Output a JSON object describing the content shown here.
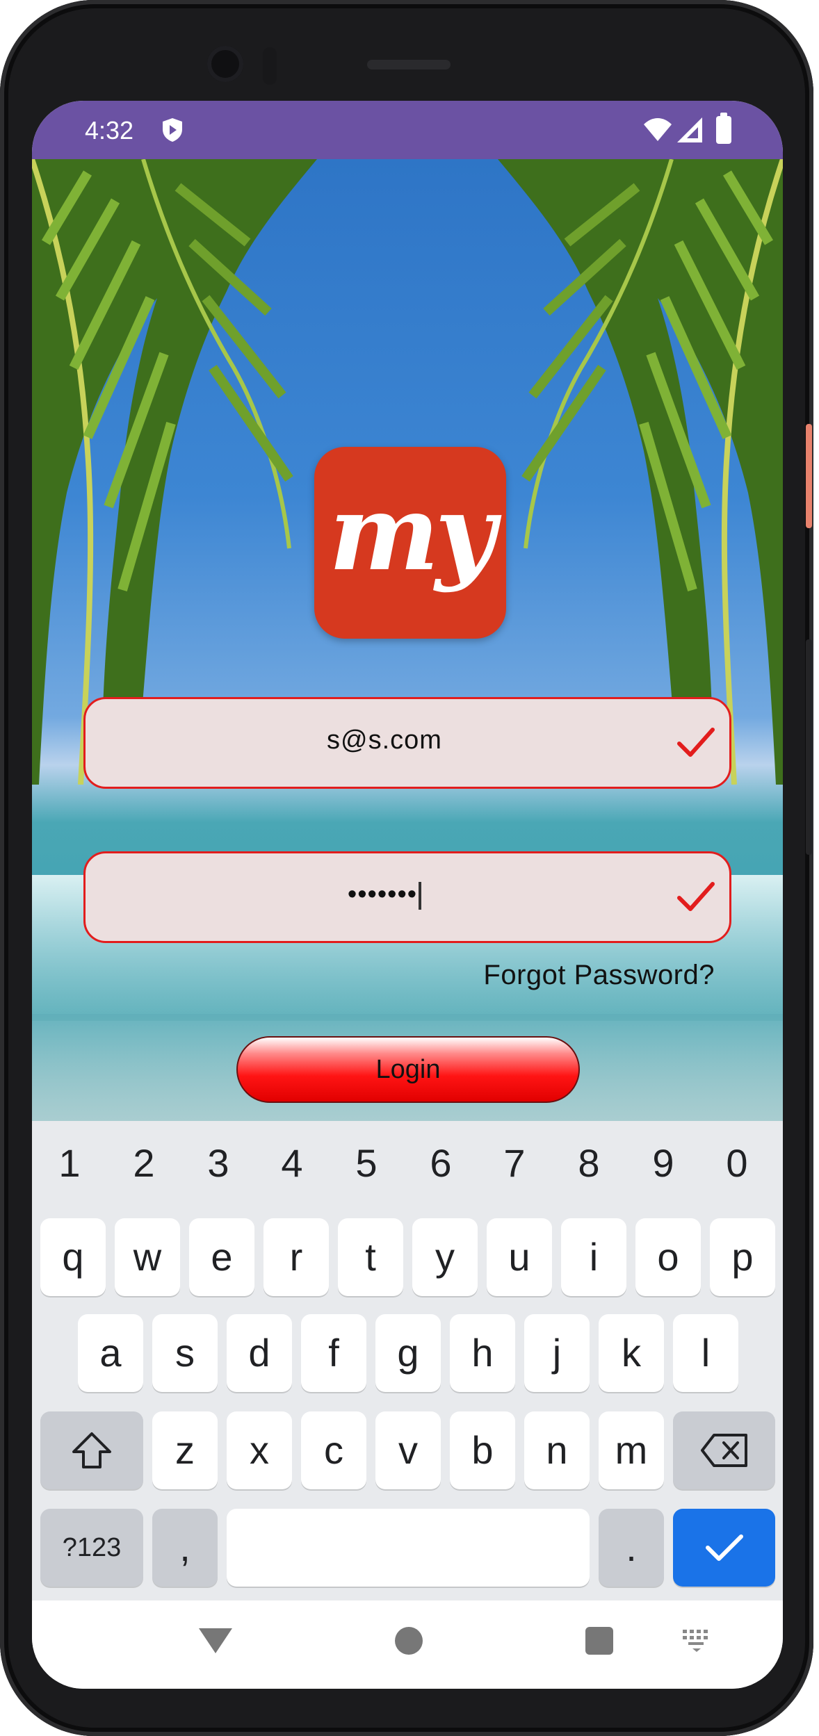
{
  "status_bar": {
    "time": "4:32",
    "icons": [
      "shield-icon",
      "wifi-icon",
      "cell-signal-icon",
      "battery-icon"
    ]
  },
  "app": {
    "logo_text": "my",
    "email": {
      "value": "s@s.com"
    },
    "password": {
      "value": "•••••••"
    },
    "forgot_password": "Forgot Password?",
    "login_button": "Login"
  },
  "keyboard": {
    "numbers": [
      "1",
      "2",
      "3",
      "4",
      "5",
      "6",
      "7",
      "8",
      "9",
      "0"
    ],
    "row1": [
      "q",
      "w",
      "e",
      "r",
      "t",
      "y",
      "u",
      "i",
      "o",
      "p"
    ],
    "row2": [
      "a",
      "s",
      "d",
      "f",
      "g",
      "h",
      "j",
      "k",
      "l"
    ],
    "row3": [
      "z",
      "x",
      "c",
      "v",
      "b",
      "n",
      "m"
    ],
    "symbols_key": "?123",
    "comma_key": ",",
    "period_key": "."
  },
  "colors": {
    "status_bar": "#6b52a3",
    "logo": "#d6391f",
    "field_border": "#e21d1d",
    "login": "#ff1414",
    "enter_key": "#1a73e8"
  }
}
